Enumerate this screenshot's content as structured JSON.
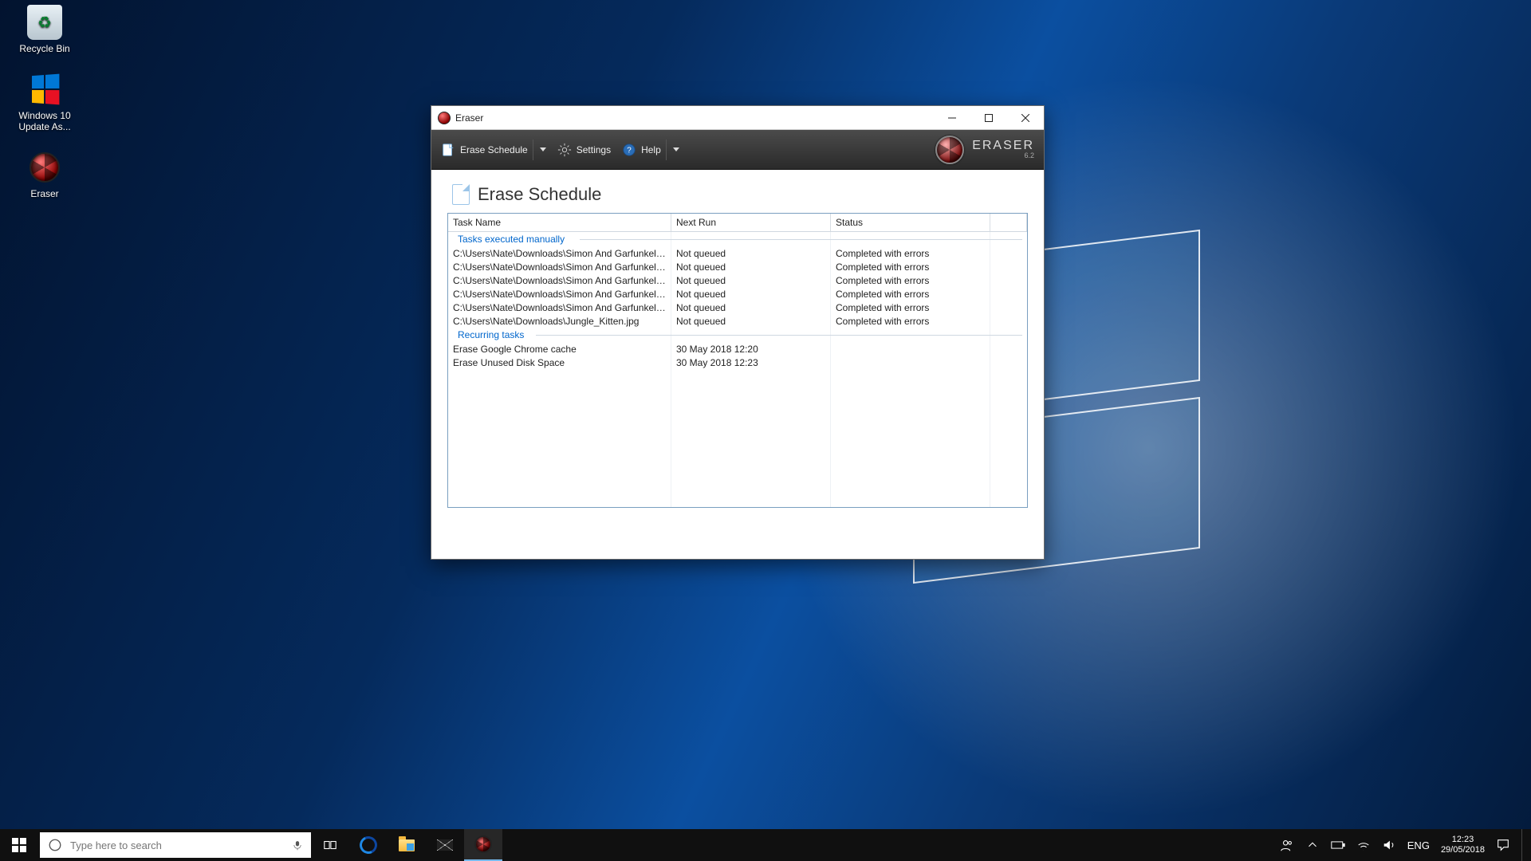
{
  "desktop_icons": [
    {
      "label": "Recycle Bin",
      "kind": "bin"
    },
    {
      "label": "Windows 10 Update As...",
      "kind": "win"
    },
    {
      "label": "Eraser",
      "kind": "eraser"
    }
  ],
  "window": {
    "title": "Eraser",
    "brand": "ERASER",
    "brand_ver": "6.2",
    "toolbar": {
      "erase_schedule": "Erase Schedule",
      "settings": "Settings",
      "help": "Help"
    },
    "page_title": "Erase Schedule",
    "columns": [
      "Task Name",
      "Next Run",
      "Status",
      ""
    ],
    "section_manual": "Tasks executed manually",
    "section_recurring": "Recurring tasks",
    "manual_tasks": [
      {
        "name": "C:\\Users\\Nate\\Downloads\\Simon And Garfunkel ...",
        "next": "Not queued",
        "status": "Completed with errors"
      },
      {
        "name": "C:\\Users\\Nate\\Downloads\\Simon And Garfunkel ...",
        "next": "Not queued",
        "status": "Completed with errors"
      },
      {
        "name": "C:\\Users\\Nate\\Downloads\\Simon And Garfunkel ...",
        "next": "Not queued",
        "status": "Completed with errors"
      },
      {
        "name": "C:\\Users\\Nate\\Downloads\\Simon And Garfunkel ...",
        "next": "Not queued",
        "status": "Completed with errors"
      },
      {
        "name": "C:\\Users\\Nate\\Downloads\\Simon And Garfunkel ...",
        "next": "Not queued",
        "status": "Completed with errors"
      },
      {
        "name": "C:\\Users\\Nate\\Downloads\\Jungle_Kitten.jpg",
        "next": "Not queued",
        "status": "Completed with errors"
      }
    ],
    "recurring_tasks": [
      {
        "name": "Erase Google Chrome cache",
        "next": "30 May 2018 12:20",
        "status": ""
      },
      {
        "name": "Erase Unused Disk Space",
        "next": "30 May 2018 12:23",
        "status": ""
      }
    ]
  },
  "taskbar": {
    "search_placeholder": "Type here to search",
    "lang": "ENG",
    "time": "12:23",
    "date": "29/05/2018"
  }
}
